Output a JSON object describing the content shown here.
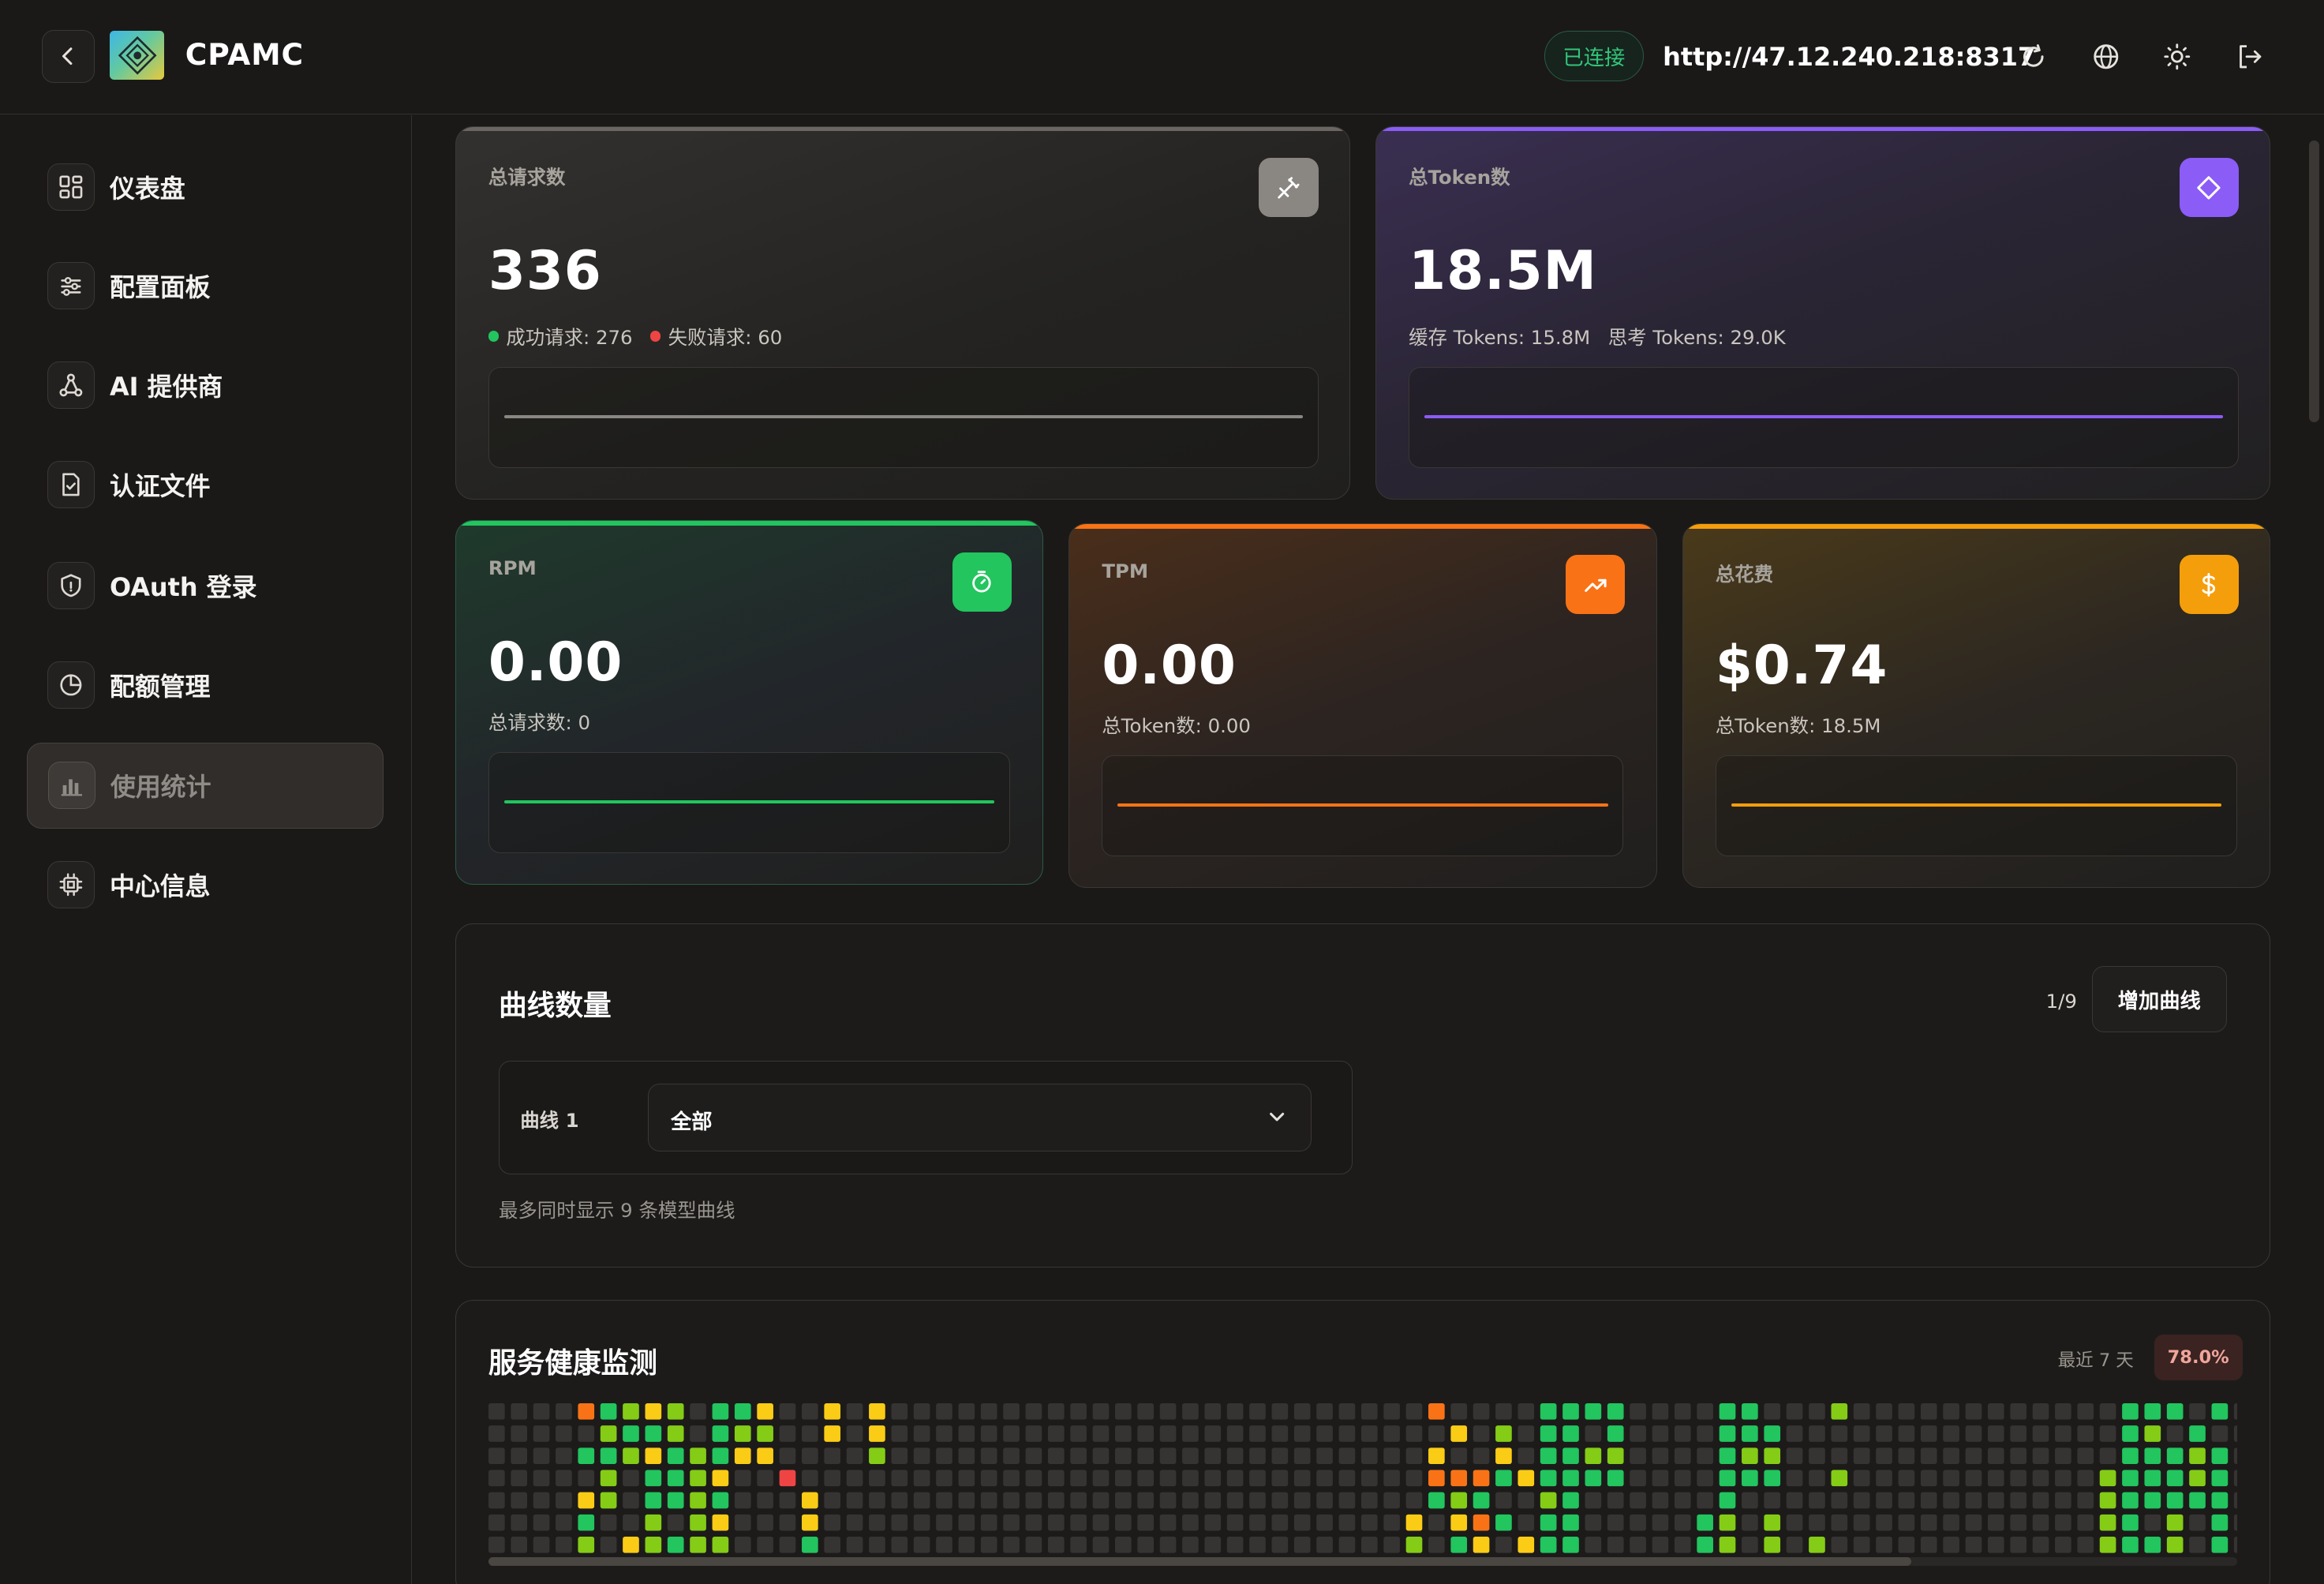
{
  "header": {
    "brand": "CPAMC",
    "connection_status": "已连接",
    "server_url": "http://47.12.240.218:8317",
    "icons": [
      "back-icon",
      "logo-icon",
      "refresh-icon",
      "globe-icon",
      "theme-icon",
      "logout-icon"
    ]
  },
  "sidebar": {
    "items": [
      {
        "label": "仪表盘",
        "icon": "dashboard-icon"
      },
      {
        "label": "配置面板",
        "icon": "sliders-icon"
      },
      {
        "label": "AI 提供商",
        "icon": "network-icon"
      },
      {
        "label": "认证文件",
        "icon": "file-check-icon"
      },
      {
        "label": "OAuth 登录",
        "icon": "shield-icon"
      },
      {
        "label": "配额管理",
        "icon": "pie-chart-icon"
      },
      {
        "label": "使用统计",
        "icon": "bar-chart-icon",
        "active": true
      },
      {
        "label": "中心信息",
        "icon": "chip-icon"
      }
    ]
  },
  "stats": {
    "total_requests": {
      "label": "总请求数",
      "value": "336",
      "success_label": "成功请求: 276",
      "failed_label": "失败请求: 60",
      "color": "#8a8682",
      "icon": "plug-icon"
    },
    "total_tokens": {
      "label": "总Token数",
      "value": "18.5M",
      "cache_label": "缓存 Tokens: 15.8M",
      "thinking_label": "思考 Tokens: 29.0K",
      "color": "#8b5cf6",
      "icon": "diamond-icon"
    },
    "rpm": {
      "label": "RPM",
      "value": "0.00",
      "sub": "总请求数: 0",
      "color": "#22c55e",
      "icon": "timer-icon"
    },
    "tpm": {
      "label": "TPM",
      "value": "0.00",
      "sub": "总Token数: 0.00",
      "color": "#f97316",
      "icon": "trending-up-icon"
    },
    "cost": {
      "label": "总花费",
      "value": "$0.74",
      "sub": "总Token数: 18.5M",
      "color": "#f59e0b",
      "icon": "dollar-icon"
    }
  },
  "curves": {
    "title": "曲线数量",
    "count": "1/9",
    "add_button": "增加曲线",
    "curve_label": "曲线 1",
    "selected": "全部",
    "hint": "最多同时显示 9 条模型曲线"
  },
  "health": {
    "title": "服务健康监测",
    "range": "最近 7 天",
    "rate": "78.0%",
    "colors": {
      "empty": "#363432",
      "ok": "#22c55e",
      "good": "#84cc16",
      "warn": "#eab308",
      "mid": "#facc15",
      "bad": "#f97316",
      "fail": "#ef4444"
    },
    "rows": [
      "....o.g.gg...gl...................y...yy...................................gg...............",
      ".....lg.ll.l...................................................................................",
      "..............................................................................................."
    ]
  }
}
